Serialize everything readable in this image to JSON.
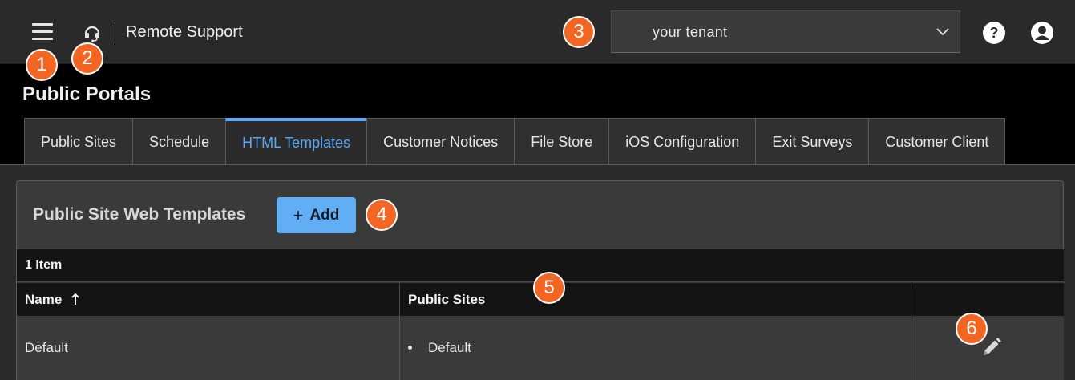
{
  "header": {
    "app_name": "Remote Support",
    "tenant_value": "your tenant",
    "menu_icon": "hamburger-menu-icon",
    "app_icon": "headset-icon",
    "help_icon": "help-circle-icon",
    "user_icon": "user-account-icon",
    "chevron_icon": "chevron-down-icon"
  },
  "page": {
    "title": "Public Portals"
  },
  "tabs": [
    {
      "label": "Public Sites",
      "active": false
    },
    {
      "label": "Schedule",
      "active": false
    },
    {
      "label": "HTML Templates",
      "active": true
    },
    {
      "label": "Customer Notices",
      "active": false
    },
    {
      "label": "File Store",
      "active": false
    },
    {
      "label": "iOS Configuration",
      "active": false
    },
    {
      "label": "Exit Surveys",
      "active": false
    },
    {
      "label": "Customer Client",
      "active": false
    }
  ],
  "panel": {
    "title": "Public Site Web Templates",
    "add_label": "Add",
    "add_icon": "plus-icon",
    "item_count": "1 Item"
  },
  "table": {
    "columns": [
      "Name",
      "Public Sites",
      ""
    ],
    "sort_icon": "sort-ascending-arrow-icon",
    "rows": [
      {
        "name": "Default",
        "public_sites": [
          "Default"
        ],
        "action_icon": "pencil-edit-icon"
      }
    ]
  },
  "annotations": [
    "1",
    "2",
    "3",
    "4",
    "5",
    "6"
  ],
  "colors": {
    "accent": "#5aa9f2",
    "button": "#62aef4",
    "badge": "#f26522",
    "topbar": "#2a2a2a",
    "background": "#000000"
  }
}
